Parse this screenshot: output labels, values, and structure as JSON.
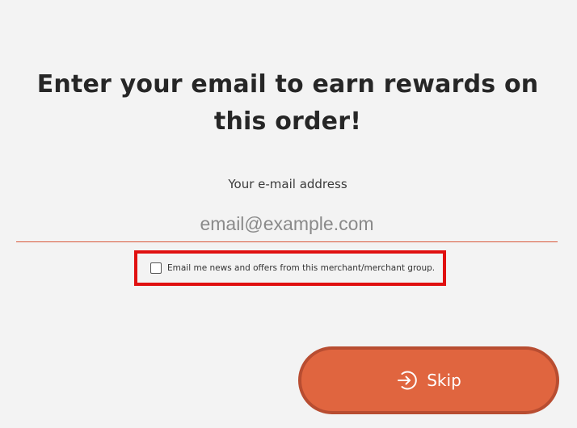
{
  "headline": "Enter your email to earn rewards on this order!",
  "email": {
    "label": "Your e-mail address",
    "placeholder": "email@example.com",
    "value": ""
  },
  "optin": {
    "label": "Email me news and offers from this merchant/merchant group.",
    "checked": false
  },
  "skip_button": {
    "label": "Skip",
    "icon": "login-arrow-icon"
  },
  "colors": {
    "accent": "#e0653f",
    "accent_border": "#b84d31",
    "underline": "#d9573a",
    "highlight": "#e01010",
    "background": "#f3f3f3"
  }
}
